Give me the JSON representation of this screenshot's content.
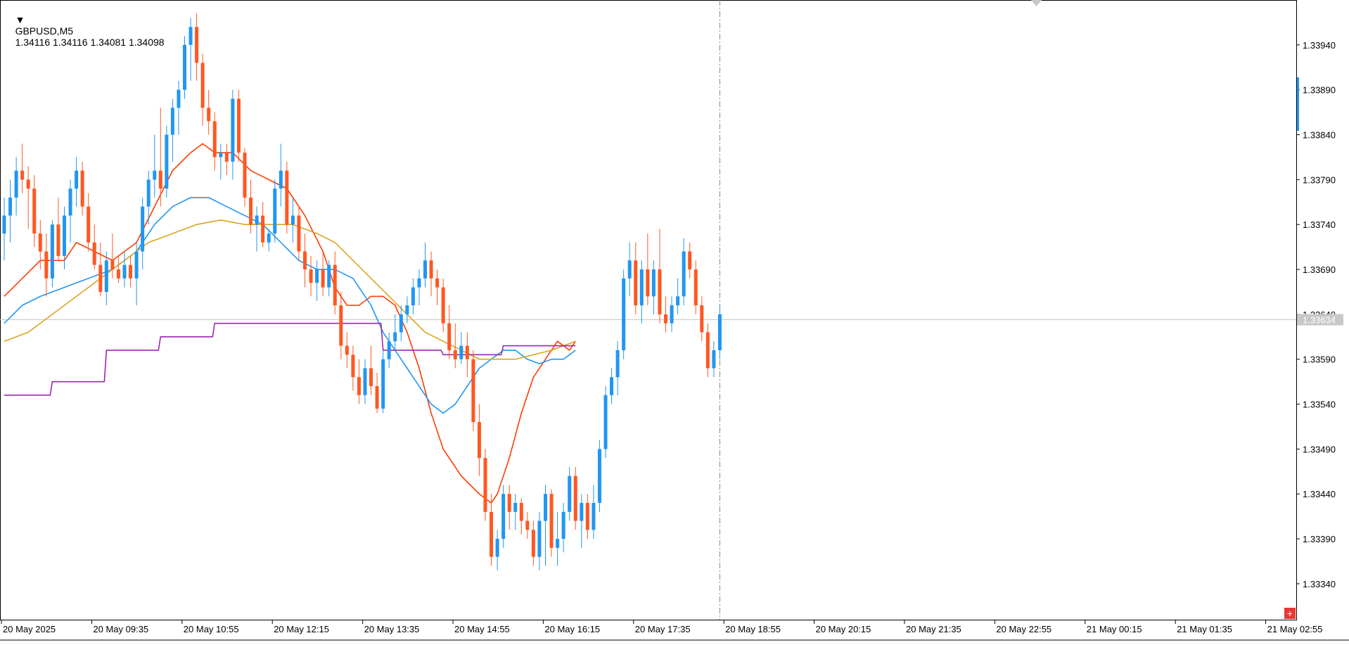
{
  "header": {
    "symbol": "GBPUSD,M5",
    "ohlc": "1.34116 1.34116 1.34081 1.34098"
  },
  "colors": {
    "bull": "#2196F3",
    "bear": "#FF5722",
    "ma_fast": "#FF3D00",
    "ma_mid": "#2196F3",
    "ma_slow": "#DAA520",
    "step_line": "#9C27B0",
    "bid_line": "#C8C8C8",
    "bid_label_bg": "#C8C8C8",
    "grid_text": "#000000"
  },
  "chart_data": {
    "type": "candlestick",
    "symbol": "GBPUSD",
    "timeframe": "M5",
    "ylim": [
      1.333,
      1.3399
    ],
    "y_ticks": [
      "1.33940",
      "1.33890",
      "1.33840",
      "1.33790",
      "1.33740",
      "1.33690",
      "1.33640",
      "1.33590",
      "1.33540",
      "1.33490",
      "1.33440",
      "1.33390",
      "1.33340"
    ],
    "x_ticks": [
      "20 May 2025",
      "20 May 09:35",
      "20 May 10:55",
      "20 May 12:15",
      "20 May 13:35",
      "20 May 14:55",
      "20 May 16:15",
      "20 May 17:35",
      "20 May 18:55",
      "20 May 20:15",
      "20 May 21:35",
      "20 May 22:55",
      "21 May 00:15",
      "21 May 01:35",
      "21 May 02:55"
    ],
    "current_price": "1.33634",
    "bid_level": 1.33634,
    "candles": [
      [
        1.3373,
        1.3377,
        1.337,
        1.3375
      ],
      [
        1.3375,
        1.3379,
        1.3372,
        1.3377
      ],
      [
        1.3377,
        1.33815,
        1.3375,
        1.338
      ],
      [
        1.338,
        1.3383,
        1.33775,
        1.3379
      ],
      [
        1.3379,
        1.33805,
        1.33735,
        1.3378
      ],
      [
        1.3378,
        1.33795,
        1.33715,
        1.3373
      ],
      [
        1.3373,
        1.33745,
        1.3369,
        1.3371
      ],
      [
        1.3371,
        1.3373,
        1.3366,
        1.3368
      ],
      [
        1.3368,
        1.33745,
        1.3367,
        1.3374
      ],
      [
        1.3374,
        1.3377,
        1.337,
        1.33705
      ],
      [
        1.33705,
        1.3376,
        1.3369,
        1.3375
      ],
      [
        1.3375,
        1.3379,
        1.3372,
        1.3378
      ],
      [
        1.3378,
        1.33815,
        1.3376,
        1.338
      ],
      [
        1.338,
        1.3381,
        1.3375,
        1.3376
      ],
      [
        1.3376,
        1.33775,
        1.3371,
        1.3372
      ],
      [
        1.3372,
        1.3374,
        1.3369,
        1.33695
      ],
      [
        1.33695,
        1.3372,
        1.3366,
        1.33665
      ],
      [
        1.33665,
        1.3371,
        1.3365,
        1.337
      ],
      [
        1.337,
        1.3373,
        1.3368,
        1.3369
      ],
      [
        1.3369,
        1.33705,
        1.33675,
        1.3368
      ],
      [
        1.3368,
        1.3371,
        1.3367,
        1.33695
      ],
      [
        1.33695,
        1.33705,
        1.3367,
        1.3368
      ],
      [
        1.3368,
        1.3372,
        1.3365,
        1.3371
      ],
      [
        1.3371,
        1.3377,
        1.3369,
        1.3376
      ],
      [
        1.3376,
        1.338,
        1.3374,
        1.3379
      ],
      [
        1.3379,
        1.3384,
        1.3377,
        1.338
      ],
      [
        1.338,
        1.3387,
        1.3376,
        1.3378
      ],
      [
        1.3378,
        1.3385,
        1.3377,
        1.3384
      ],
      [
        1.3384,
        1.3388,
        1.3381,
        1.3387
      ],
      [
        1.3387,
        1.339,
        1.3384,
        1.3389
      ],
      [
        1.3389,
        1.3395,
        1.3388,
        1.3394
      ],
      [
        1.3394,
        1.3397,
        1.339,
        1.3396
      ],
      [
        1.3396,
        1.33975,
        1.339,
        1.3392
      ],
      [
        1.3392,
        1.3393,
        1.3385,
        1.3387
      ],
      [
        1.3387,
        1.3389,
        1.3384,
        1.33855
      ],
      [
        1.33855,
        1.33865,
        1.338,
        1.33815
      ],
      [
        1.33815,
        1.3383,
        1.3379,
        1.3382
      ],
      [
        1.3382,
        1.3383,
        1.33795,
        1.3381
      ],
      [
        1.3381,
        1.3389,
        1.3379,
        1.3388
      ],
      [
        1.3388,
        1.3389,
        1.3381,
        1.3382
      ],
      [
        1.3382,
        1.33825,
        1.3376,
        1.3377
      ],
      [
        1.3377,
        1.3379,
        1.3373,
        1.3374
      ],
      [
        1.3374,
        1.3376,
        1.3371,
        1.3375
      ],
      [
        1.3375,
        1.33765,
        1.33715,
        1.3372
      ],
      [
        1.3372,
        1.33735,
        1.3371,
        1.3373
      ],
      [
        1.3373,
        1.3379,
        1.3372,
        1.3378
      ],
      [
        1.3378,
        1.3383,
        1.3376,
        1.338
      ],
      [
        1.338,
        1.3381,
        1.3373,
        1.3374
      ],
      [
        1.3374,
        1.3377,
        1.3372,
        1.3375
      ],
      [
        1.3375,
        1.3376,
        1.337,
        1.3371
      ],
      [
        1.3371,
        1.3373,
        1.3367,
        1.3369
      ],
      [
        1.3369,
        1.33705,
        1.3366,
        1.33675
      ],
      [
        1.33675,
        1.337,
        1.33655,
        1.3369
      ],
      [
        1.3369,
        1.3371,
        1.3366,
        1.3367
      ],
      [
        1.3367,
        1.337,
        1.3366,
        1.33695
      ],
      [
        1.33695,
        1.3371,
        1.3364,
        1.3365
      ],
      [
        1.3365,
        1.33665,
        1.3359,
        1.33605
      ],
      [
        1.33605,
        1.3362,
        1.3358,
        1.33595
      ],
      [
        1.33595,
        1.33605,
        1.33555,
        1.3357
      ],
      [
        1.3357,
        1.3359,
        1.3354,
        1.3355
      ],
      [
        1.3355,
        1.3359,
        1.3354,
        1.3358
      ],
      [
        1.3358,
        1.33605,
        1.3355,
        1.3356
      ],
      [
        1.3356,
        1.33575,
        1.3353,
        1.33535
      ],
      [
        1.33535,
        1.336,
        1.3353,
        1.3359
      ],
      [
        1.3359,
        1.3362,
        1.3358,
        1.3361
      ],
      [
        1.3361,
        1.3364,
        1.336,
        1.3362
      ],
      [
        1.3362,
        1.3365,
        1.3361,
        1.3364
      ],
      [
        1.3364,
        1.3366,
        1.3363,
        1.3365
      ],
      [
        1.3365,
        1.3368,
        1.3364,
        1.3367
      ],
      [
        1.3367,
        1.3369,
        1.3365,
        1.3368
      ],
      [
        1.3368,
        1.3372,
        1.3367,
        1.337
      ],
      [
        1.337,
        1.3371,
        1.3366,
        1.3368
      ],
      [
        1.3368,
        1.3369,
        1.3365,
        1.3367
      ],
      [
        1.3367,
        1.3368,
        1.3362,
        1.3363
      ],
      [
        1.3363,
        1.3365,
        1.3359,
        1.336
      ],
      [
        1.336,
        1.3363,
        1.3358,
        1.3359
      ],
      [
        1.3359,
        1.3362,
        1.33585,
        1.33605
      ],
      [
        1.33605,
        1.3362,
        1.3357,
        1.3359
      ],
      [
        1.3359,
        1.336,
        1.3351,
        1.3352
      ],
      [
        1.3352,
        1.3354,
        1.3346,
        1.3348
      ],
      [
        1.3348,
        1.3349,
        1.3341,
        1.3342
      ],
      [
        1.3342,
        1.3344,
        1.3336,
        1.3337
      ],
      [
        1.3337,
        1.334,
        1.33355,
        1.3339
      ],
      [
        1.3339,
        1.3345,
        1.3338,
        1.3344
      ],
      [
        1.3344,
        1.3345,
        1.334,
        1.3342
      ],
      [
        1.3342,
        1.3344,
        1.334,
        1.3343
      ],
      [
        1.3343,
        1.33435,
        1.33395,
        1.3341
      ],
      [
        1.3341,
        1.3342,
        1.3339,
        1.334
      ],
      [
        1.334,
        1.3341,
        1.3336,
        1.3337
      ],
      [
        1.3337,
        1.3342,
        1.33355,
        1.3341
      ],
      [
        1.3341,
        1.3345,
        1.3336,
        1.3344
      ],
      [
        1.3344,
        1.33445,
        1.3337,
        1.3338
      ],
      [
        1.3338,
        1.3342,
        1.3336,
        1.3339
      ],
      [
        1.3339,
        1.3343,
        1.33375,
        1.3342
      ],
      [
        1.3342,
        1.3347,
        1.3341,
        1.3346
      ],
      [
        1.3346,
        1.3347,
        1.334,
        1.3341
      ],
      [
        1.3341,
        1.3344,
        1.3338,
        1.3343
      ],
      [
        1.3343,
        1.3344,
        1.3339,
        1.334
      ],
      [
        1.334,
        1.3345,
        1.3339,
        1.3343
      ],
      [
        1.3343,
        1.335,
        1.3342,
        1.3349
      ],
      [
        1.3349,
        1.3356,
        1.3348,
        1.3355
      ],
      [
        1.3355,
        1.3358,
        1.3354,
        1.3357
      ],
      [
        1.3357,
        1.3361,
        1.3355,
        1.336
      ],
      [
        1.336,
        1.3369,
        1.3359,
        1.3368
      ],
      [
        1.3368,
        1.3372,
        1.3366,
        1.337
      ],
      [
        1.337,
        1.3372,
        1.3364,
        1.3365
      ],
      [
        1.3365,
        1.337,
        1.3363,
        1.3369
      ],
      [
        1.3369,
        1.3373,
        1.3365,
        1.3366
      ],
      [
        1.3366,
        1.337,
        1.3364,
        1.3369
      ],
      [
        1.3369,
        1.33735,
        1.3363,
        1.3364
      ],
      [
        1.3364,
        1.3366,
        1.3362,
        1.3363
      ],
      [
        1.3363,
        1.3366,
        1.3362,
        1.3365
      ],
      [
        1.3365,
        1.3368,
        1.3364,
        1.3366
      ],
      [
        1.3366,
        1.33725,
        1.3365,
        1.3371
      ],
      [
        1.3371,
        1.3372,
        1.3368,
        1.3369
      ],
      [
        1.3369,
        1.337,
        1.3364,
        1.3365
      ],
      [
        1.3365,
        1.3366,
        1.3361,
        1.3362
      ],
      [
        1.3362,
        1.3363,
        1.3357,
        1.3358
      ],
      [
        1.3358,
        1.3361,
        1.3357,
        1.336
      ],
      [
        1.336,
        1.3365,
        1.3359,
        1.3364
      ]
    ],
    "series": [
      {
        "type": "line",
        "color": "#FF3D00",
        "points": [
          [
            0,
            1.3366
          ],
          [
            3,
            1.3368
          ],
          [
            6,
            1.337
          ],
          [
            10,
            1.337
          ],
          [
            12,
            1.3372
          ],
          [
            15,
            1.3371
          ],
          [
            18,
            1.337
          ],
          [
            22,
            1.3372
          ],
          [
            25,
            1.3376
          ],
          [
            28,
            1.338
          ],
          [
            31,
            1.3382
          ],
          [
            33,
            1.3383
          ],
          [
            35,
            1.3382
          ],
          [
            38,
            1.3382
          ],
          [
            41,
            1.338
          ],
          [
            44,
            1.3379
          ],
          [
            47,
            1.3378
          ],
          [
            50,
            1.3375
          ],
          [
            53,
            1.3371
          ],
          [
            55,
            1.3367
          ],
          [
            57,
            1.3365
          ],
          [
            59,
            1.3365
          ],
          [
            61,
            1.3366
          ],
          [
            63,
            1.3366
          ],
          [
            65,
            1.3365
          ],
          [
            67,
            1.3362
          ],
          [
            69,
            1.3358
          ],
          [
            71,
            1.3353
          ],
          [
            73,
            1.3349
          ],
          [
            76,
            1.3346
          ],
          [
            79,
            1.3344
          ],
          [
            81,
            1.3343
          ],
          [
            82,
            1.3344
          ],
          [
            84,
            1.3348
          ],
          [
            86,
            1.3353
          ],
          [
            88,
            1.3357
          ],
          [
            90,
            1.3359
          ],
          [
            91,
            1.336
          ],
          [
            92,
            1.3361
          ],
          [
            94,
            1.336
          ],
          [
            95,
            1.3361
          ]
        ]
      },
      {
        "type": "line",
        "color": "#2196F3",
        "points": [
          [
            0,
            1.3363
          ],
          [
            3,
            1.3365
          ],
          [
            6,
            1.3366
          ],
          [
            10,
            1.3367
          ],
          [
            14,
            1.3368
          ],
          [
            18,
            1.3369
          ],
          [
            22,
            1.3371
          ],
          [
            25,
            1.3374
          ],
          [
            28,
            1.3376
          ],
          [
            31,
            1.3377
          ],
          [
            34,
            1.3377
          ],
          [
            37,
            1.3376
          ],
          [
            40,
            1.3375
          ],
          [
            43,
            1.3374
          ],
          [
            46,
            1.3372
          ],
          [
            49,
            1.337
          ],
          [
            52,
            1.3369
          ],
          [
            55,
            1.3369
          ],
          [
            58,
            1.3368
          ],
          [
            61,
            1.3365
          ],
          [
            63,
            1.3362
          ],
          [
            65,
            1.336
          ],
          [
            67,
            1.3358
          ],
          [
            69,
            1.3356
          ],
          [
            71,
            1.3354
          ],
          [
            73,
            1.3353
          ],
          [
            75,
            1.3354
          ],
          [
            77,
            1.3356
          ],
          [
            79,
            1.3358
          ],
          [
            81,
            1.3359
          ],
          [
            83,
            1.336
          ],
          [
            85,
            1.336
          ],
          [
            87,
            1.3359
          ],
          [
            89,
            1.33585
          ],
          [
            91,
            1.3359
          ],
          [
            93,
            1.3359
          ],
          [
            95,
            1.336
          ]
        ]
      },
      {
        "type": "line",
        "color": "#DAA520",
        "points": [
          [
            0,
            1.3361
          ],
          [
            4,
            1.3362
          ],
          [
            8,
            1.3364
          ],
          [
            12,
            1.3366
          ],
          [
            16,
            1.3368
          ],
          [
            20,
            1.337
          ],
          [
            24,
            1.3372
          ],
          [
            28,
            1.3373
          ],
          [
            32,
            1.3374
          ],
          [
            36,
            1.33745
          ],
          [
            40,
            1.3374
          ],
          [
            44,
            1.3374
          ],
          [
            48,
            1.3374
          ],
          [
            52,
            1.3373
          ],
          [
            55,
            1.3372
          ],
          [
            58,
            1.337
          ],
          [
            61,
            1.3368
          ],
          [
            64,
            1.3366
          ],
          [
            67,
            1.3364
          ],
          [
            70,
            1.3362
          ],
          [
            73,
            1.3361
          ],
          [
            76,
            1.336
          ],
          [
            79,
            1.3359
          ],
          [
            82,
            1.3359
          ],
          [
            85,
            1.3359
          ],
          [
            88,
            1.33595
          ],
          [
            91,
            1.336
          ],
          [
            95,
            1.3361
          ]
        ]
      },
      {
        "type": "step",
        "color": "#9C27B0",
        "points": [
          [
            0,
            1.3355
          ],
          [
            8,
            1.33565
          ],
          [
            17,
            1.336
          ],
          [
            26,
            1.33615
          ],
          [
            35,
            1.3363
          ],
          [
            63,
            1.336
          ],
          [
            73,
            1.33595
          ],
          [
            83,
            1.33605
          ],
          [
            95,
            1.33605
          ]
        ]
      }
    ]
  },
  "corner_badge": "+"
}
